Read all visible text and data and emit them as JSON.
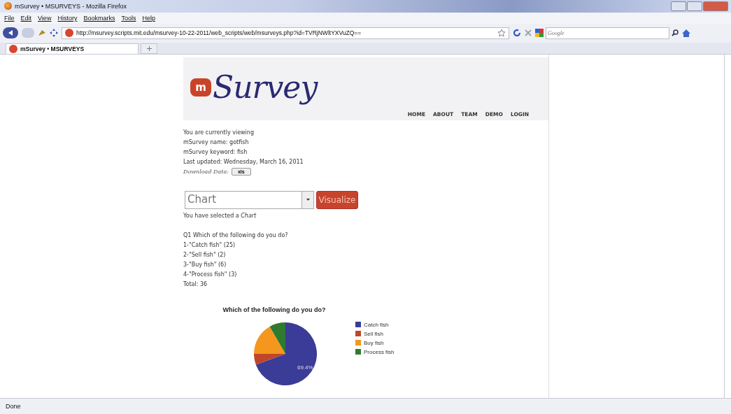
{
  "window": {
    "title": "mSurvey • MSURVEYS - Mozilla Firefox"
  },
  "menu": [
    {
      "label": "File"
    },
    {
      "label": "Edit"
    },
    {
      "label": "View"
    },
    {
      "label": "History"
    },
    {
      "label": "Bookmarks"
    },
    {
      "label": "Tools"
    },
    {
      "label": "Help"
    }
  ],
  "address_bar": {
    "url": "http://msurvey.scripts.mit.edu/msurvey-10-22-2011/web_scripts/web/msurveys.php?id=TVRjNWltYXVuZQ=="
  },
  "search": {
    "placeholder": "Google"
  },
  "tabs": [
    {
      "label": "mSurvey • MSURVEYS",
      "selected": true
    }
  ],
  "page": {
    "logo_mark": "m",
    "logo_text": "Survey",
    "nav": [
      {
        "label": "HOME"
      },
      {
        "label": "ABOUT"
      },
      {
        "label": "TEAM"
      },
      {
        "label": "DEMO"
      },
      {
        "label": "LOGIN"
      }
    ],
    "info": [
      "You are currently viewing",
      "mSurvey name: gotfish",
      "mSurvey keyword: fish",
      "Last updated: Wednesday, March 16, 2011"
    ],
    "download_label": "Download Data:",
    "download_button": "xls",
    "view_select": {
      "value": "Chart"
    },
    "visualize_button": "Visualize",
    "selection_note": "You have selected a *Chart*",
    "question": "Q1 Which of the following do you do?",
    "answers": [
      "1-\"Catch fish\" (25)",
      "2-\"Sell fish\" (2)",
      "3-\"Buy fish\" (6)",
      "4-\"Process fish\" (3)"
    ],
    "total": "Total: 36",
    "chart_data": {
      "type": "pie",
      "title": "Which of the following do you do?",
      "categories": [
        "Catch fish",
        "Sell fish",
        "Buy fish",
        "Process fish"
      ],
      "values": [
        69.4,
        5.6,
        16.7,
        8.3
      ],
      "colors": [
        "#3b3b98",
        "#c0462a",
        "#f5961e",
        "#2f7a2f"
      ],
      "value_labels": [
        "69.4%",
        null,
        null,
        null
      ],
      "legend": "right"
    }
  },
  "status_bar": {
    "text": "Done"
  }
}
